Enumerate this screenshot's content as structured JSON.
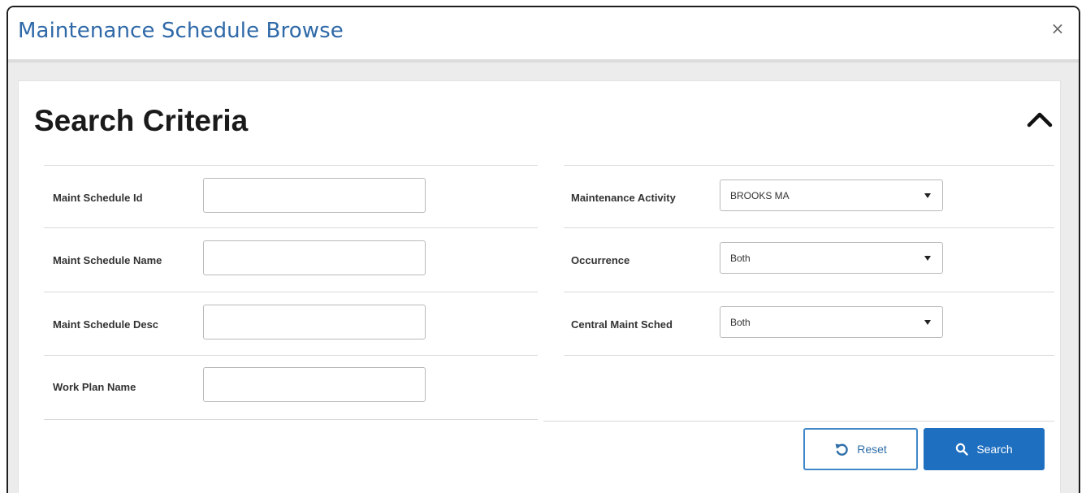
{
  "window": {
    "title": "Maintenance Schedule Browse",
    "close_label": "×"
  },
  "search_criteria": {
    "heading": "Search Criteria",
    "collapse_icon": "chevron-up-icon",
    "left_fields": [
      {
        "label": "Maint Schedule Id",
        "value": "",
        "placeholder": ""
      },
      {
        "label": "Maint Schedule Name",
        "value": "",
        "placeholder": ""
      },
      {
        "label": "Maint Schedule Desc",
        "value": "",
        "placeholder": ""
      },
      {
        "label": "Work Plan Name",
        "value": "",
        "placeholder": ""
      }
    ],
    "right_fields": [
      {
        "label": "Maintenance Activity",
        "selected": "BROOKS MA"
      },
      {
        "label": "Occurrence",
        "selected": "Both"
      },
      {
        "label": "Central Maint Sched",
        "selected": "Both"
      }
    ]
  },
  "actions": {
    "reset_label": "Reset",
    "reset_icon": "undo-icon",
    "search_label": "Search",
    "search_icon": "search-icon"
  },
  "colors": {
    "title": "#2f69a8",
    "primary": "#1e6fc0",
    "panel_bg": "#ececec"
  }
}
